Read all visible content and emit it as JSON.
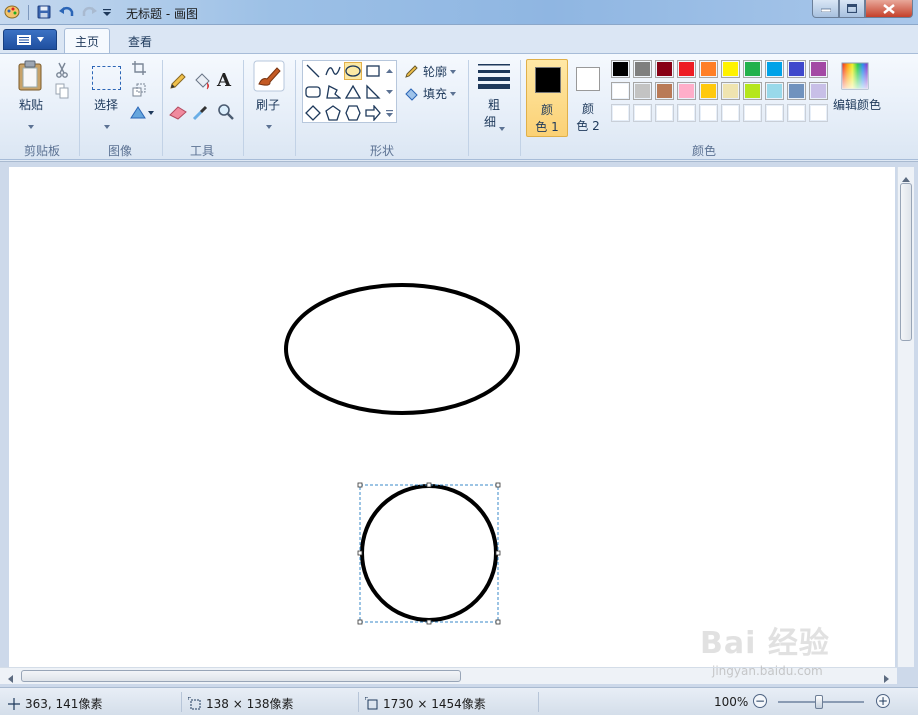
{
  "window": {
    "title": "无标题 - 画图"
  },
  "tabs": [
    {
      "label": "主页",
      "active": true
    },
    {
      "label": "查看",
      "active": false
    }
  ],
  "help": {
    "label": "?"
  },
  "ribbon": {
    "clipboard": {
      "paste_label": "粘贴",
      "group_label": "剪贴板"
    },
    "image": {
      "select_label": "选择",
      "group_label": "图像"
    },
    "tools": {
      "group_label": "工具"
    },
    "brushes": {
      "label": "刷子"
    },
    "shapes": {
      "outline_label": "轮廓",
      "fill_label": "填充",
      "group_label": "形状"
    },
    "size": {
      "label_1": "粗",
      "label_2": "细"
    },
    "color1": {
      "label_1": "颜",
      "label_2": "色 1",
      "value": "#000000"
    },
    "color2": {
      "label_1": "颜",
      "label_2": "色 2",
      "value": "#ffffff"
    },
    "colors": {
      "group_label": "颜色",
      "edit_label": "编辑颜色",
      "row1": [
        "#000000",
        "#7f7f7f",
        "#880015",
        "#ed1c24",
        "#ff7f27",
        "#fff200",
        "#22b14c",
        "#00a2e8",
        "#3f48cc",
        "#a349a4"
      ],
      "row2": [
        "#ffffff",
        "#c3c3c3",
        "#b97a57",
        "#ffaec9",
        "#ffc90e",
        "#efe4b0",
        "#b5e61d",
        "#99d9ea",
        "#7092be",
        "#c8bfe7"
      ],
      "row3": [
        "#ffffff",
        "#ffffff",
        "#ffffff",
        "#ffffff",
        "#ffffff",
        "#ffffff",
        "#ffffff",
        "#ffffff",
        "#ffffff",
        "#ffffff"
      ]
    }
  },
  "status": {
    "cursor": "363, 141像素",
    "selection": "138 × 138像素",
    "canvas_size": "1730 × 1454像素",
    "zoom": "100%",
    "zoom_out": "−",
    "zoom_in": "+"
  },
  "watermark": {
    "text": "Bai 经验",
    "url": "jingyan.baidu.com"
  }
}
